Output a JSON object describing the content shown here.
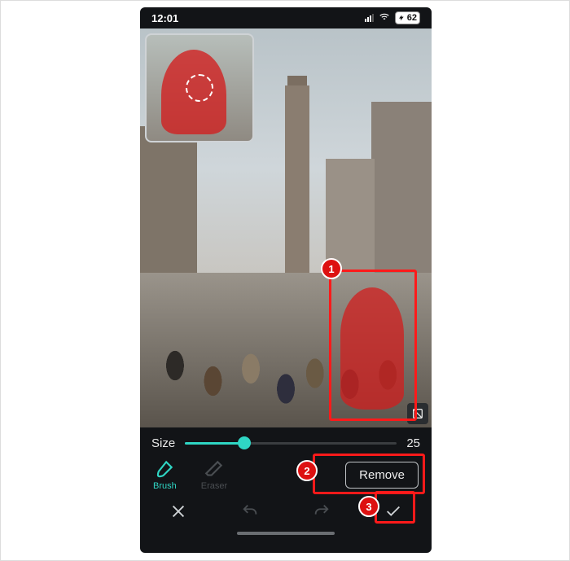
{
  "status": {
    "time": "12:01",
    "battery": "62"
  },
  "size": {
    "label": "Size",
    "value": "25",
    "percent": 28
  },
  "tools": {
    "brush": {
      "label": "Brush",
      "active": true
    },
    "eraser": {
      "label": "Eraser",
      "active": false
    }
  },
  "remove": {
    "label": "Remove"
  },
  "annotations": {
    "step1": "1",
    "step2": "2",
    "step3": "3"
  }
}
